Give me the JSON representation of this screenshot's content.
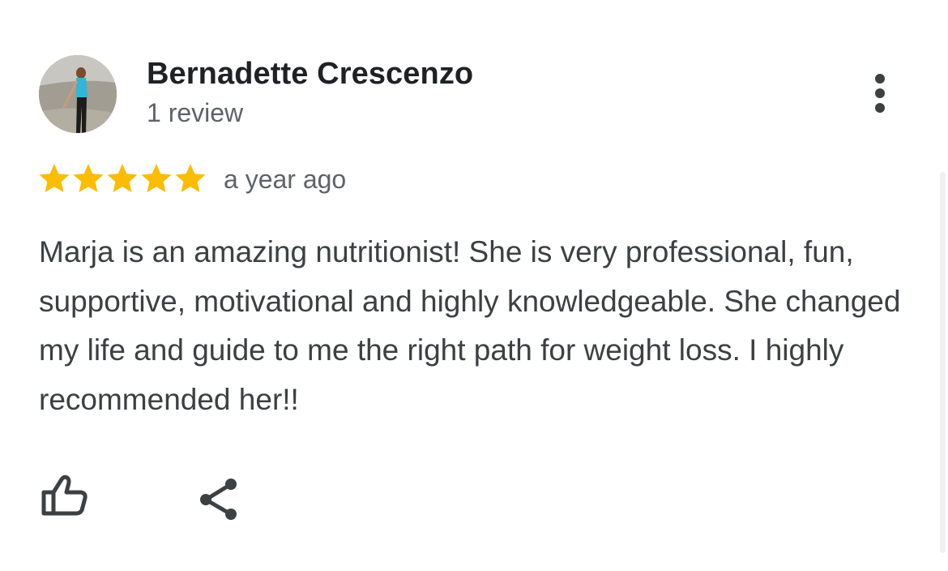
{
  "reviewer": {
    "name": "Bernadette Crescenzo",
    "review_count": "1 review",
    "avatar_icon": "profile-photo"
  },
  "review": {
    "rating": 5,
    "rating_max": 5,
    "time": "a year ago",
    "text": "Marja is an amazing nutritionist! She is very professional, fun, supportive, motivational and highly knowledgeable. She changed my life and guide to me the right path for weight loss. I highly recommended her!!"
  },
  "actions": {
    "more_icon": "more-vert-icon",
    "like_icon": "thumb-up-icon",
    "share_icon": "share-icon"
  },
  "colors": {
    "star": "#fbbc04",
    "name": "#202124",
    "secondary_text": "#5f6368",
    "body_text": "#3c4043",
    "icon": "#3c4043"
  }
}
